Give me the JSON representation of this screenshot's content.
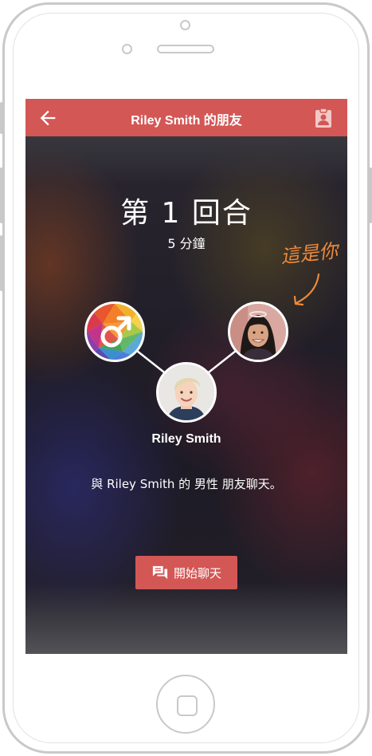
{
  "app_bar": {
    "title": "Riley Smith 的朋友",
    "back_icon": "arrow-left-icon",
    "action_icon": "clipboard-account-icon",
    "color": "#d35755"
  },
  "round": {
    "title": "第 1 回合",
    "duration": "5 分鐘"
  },
  "annotation": {
    "text": "這是你",
    "color": "#ef8a3a"
  },
  "friend": {
    "name": "Riley Smith"
  },
  "gender_icon": "male-symbol-icon",
  "description": "與 Riley Smith 的 男性 朋友聊天。",
  "chat_button": {
    "label": "開始聊天",
    "icon": "chat-bubbles-icon",
    "color": "#d35755"
  }
}
